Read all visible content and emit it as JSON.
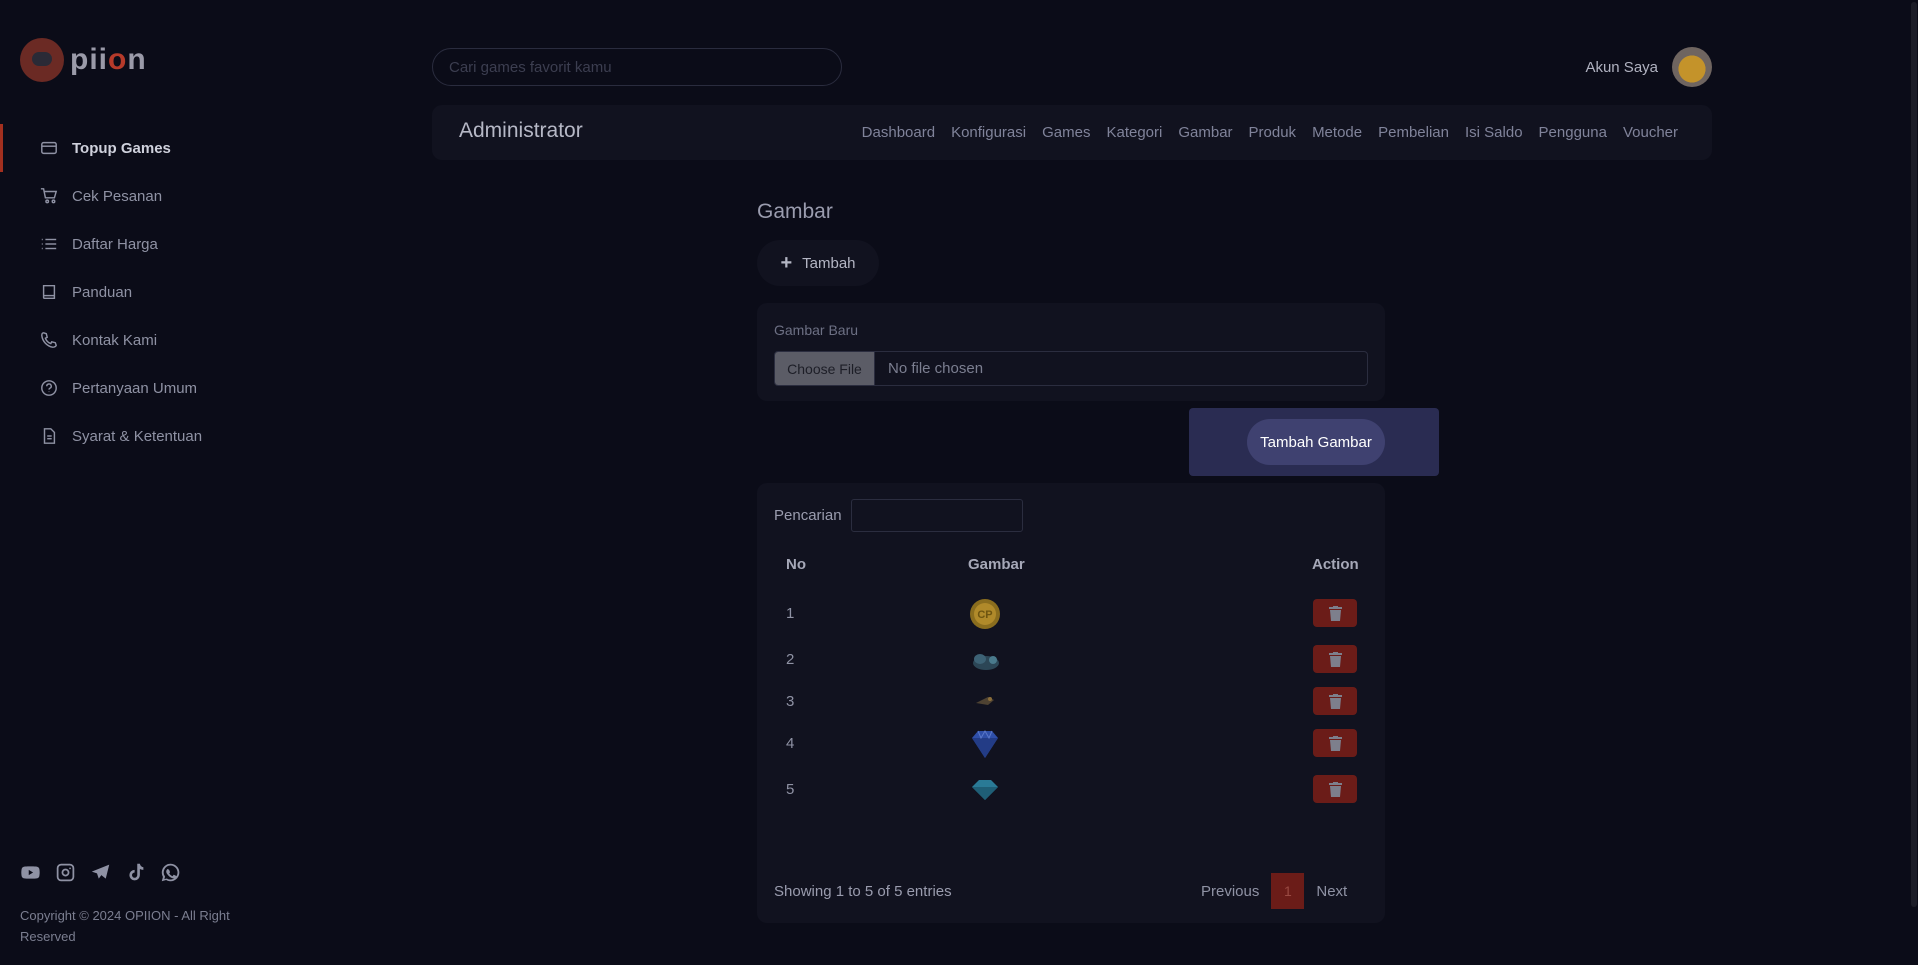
{
  "app": {
    "logo_text_pre": "pii",
    "logo_text_o": "o",
    "logo_text_post": "n"
  },
  "search": {
    "placeholder": "Cari games favorit kamu"
  },
  "account": {
    "label": "Akun Saya"
  },
  "sidebar": {
    "items": [
      {
        "label": "Topup Games",
        "icon": "card-icon",
        "active": true
      },
      {
        "label": "Cek Pesanan",
        "icon": "cart-icon",
        "active": false
      },
      {
        "label": "Daftar Harga",
        "icon": "list-icon",
        "active": false
      },
      {
        "label": "Panduan",
        "icon": "book-icon",
        "active": false
      },
      {
        "label": "Kontak Kami",
        "icon": "phone-icon",
        "active": false
      },
      {
        "label": "Pertanyaan Umum",
        "icon": "question-icon",
        "active": false
      },
      {
        "label": "Syarat & Ketentuan",
        "icon": "document-icon",
        "active": false
      }
    ],
    "socials": [
      "youtube-icon",
      "instagram-icon",
      "telegram-icon",
      "tiktok-icon",
      "whatsapp-icon"
    ],
    "copyright": "Copyright © 2024 OPIION - All Right Reserved"
  },
  "admin": {
    "title": "Administrator",
    "nav": [
      "Dashboard",
      "Konfigurasi",
      "Games",
      "Kategori",
      "Gambar",
      "Produk",
      "Metode",
      "Pembelian",
      "Isi Saldo",
      "Pengguna",
      "Voucher"
    ]
  },
  "page": {
    "title": "Gambar",
    "add_button": "Tambah",
    "upload_label": "Gambar Baru",
    "choose_file": "Choose File",
    "no_file": "No file chosen",
    "modal_button": "Tambah Gambar"
  },
  "table": {
    "search_label": "Pencarian",
    "columns": [
      "No",
      "Gambar",
      "Action"
    ],
    "rows": [
      {
        "no": "1",
        "image": "coin-image"
      },
      {
        "no": "2",
        "image": "creature-image"
      },
      {
        "no": "3",
        "image": "bird-image"
      },
      {
        "no": "4",
        "image": "blue-diamond-image"
      },
      {
        "no": "5",
        "image": "cyan-diamond-image"
      }
    ],
    "showing": "Showing 1 to 5 of 5 entries",
    "prev": "Previous",
    "page": "1",
    "next": "Next"
  },
  "colors": {
    "accent": "#a3301f",
    "delete": "#6b1c18",
    "modal": "#2a2c52"
  }
}
